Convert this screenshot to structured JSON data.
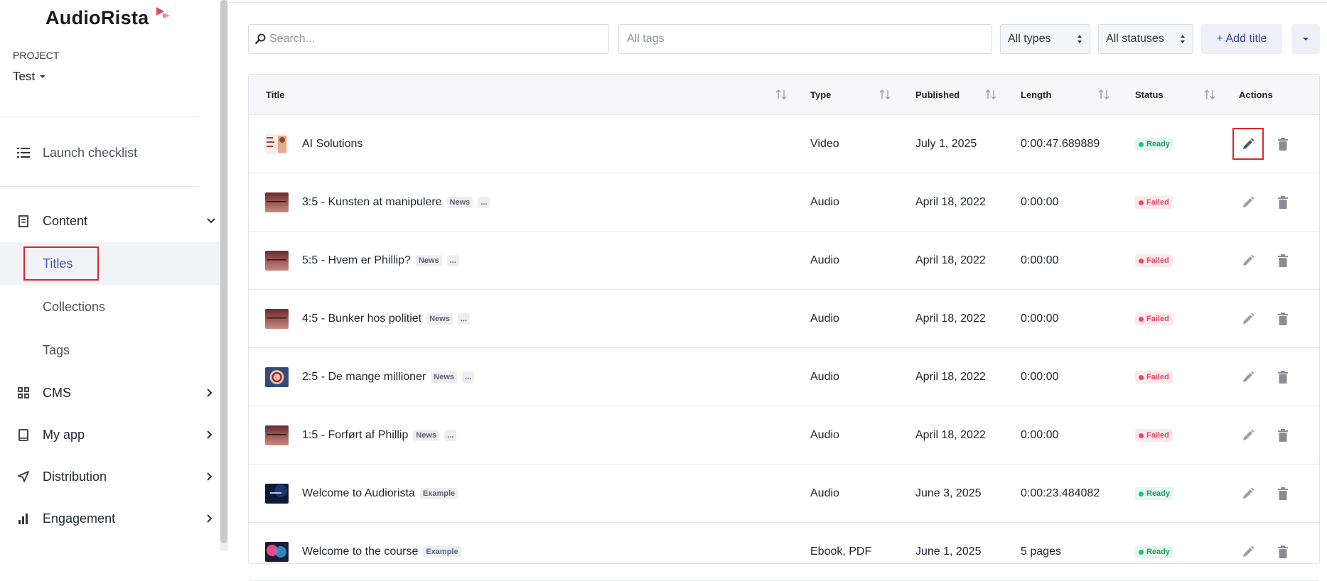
{
  "app": {
    "name": "AudioRista"
  },
  "project": {
    "label": "PROJECT",
    "value": "Test"
  },
  "sidebar": {
    "launch_checklist": "Launch checklist",
    "content": "Content",
    "sub": {
      "titles": "Titles",
      "collections": "Collections",
      "tags": "Tags"
    },
    "cms": "CMS",
    "my_app": "My app",
    "distribution": "Distribution",
    "engagement": "Engagement"
  },
  "toolbar": {
    "search_placeholder": "Search...",
    "tags_placeholder": "All tags",
    "types_value": "All types",
    "statuses_value": "All statuses",
    "add_title": "+ Add title"
  },
  "table": {
    "columns": {
      "title": "Title",
      "type": "Type",
      "published": "Published",
      "length": "Length",
      "status": "Status",
      "actions": "Actions"
    },
    "rows": [
      {
        "title": "AI Solutions",
        "tags": [],
        "type": "Video",
        "published": "July 1, 2025",
        "length": "0:00:47.689889",
        "status": "Ready",
        "thumb": "video"
      },
      {
        "title": "3:5 - Kunsten at manipulere",
        "tags": [
          "News",
          "..."
        ],
        "type": "Audio",
        "published": "April 18, 2022",
        "length": "0:00:00",
        "status": "Failed",
        "thumb": "maroon"
      },
      {
        "title": "5:5 - Hvem er Phillip?",
        "tags": [
          "News",
          "..."
        ],
        "type": "Audio",
        "published": "April 18, 2022",
        "length": "0:00:00",
        "status": "Failed",
        "thumb": "maroon"
      },
      {
        "title": "4:5 - Bunker hos politiet",
        "tags": [
          "News",
          "..."
        ],
        "type": "Audio",
        "published": "April 18, 2022",
        "length": "0:00:00",
        "status": "Failed",
        "thumb": "maroon"
      },
      {
        "title": "2:5 - De mange millioner",
        "tags": [
          "News",
          "..."
        ],
        "type": "Audio",
        "published": "April 18, 2022",
        "length": "0:00:00",
        "status": "Failed",
        "thumb": "coin"
      },
      {
        "title": "1:5 - Forført af Phillip",
        "tags": [
          "News",
          "..."
        ],
        "type": "Audio",
        "published": "April 18, 2022",
        "length": "0:00:00",
        "status": "Failed",
        "thumb": "maroon"
      },
      {
        "title": "Welcome to Audiorista",
        "tags": [
          "Example"
        ],
        "type": "Audio",
        "published": "June 3, 2025",
        "length": "0:00:23.484082",
        "status": "Ready",
        "thumb": "dark-blue"
      },
      {
        "title": "Welcome to the course",
        "tags": [
          "Example"
        ],
        "type": "Ebook, PDF",
        "published": "June 1, 2025",
        "length": "5 pages",
        "status": "Ready",
        "thumb": "colorful"
      }
    ]
  },
  "colors": {
    "accent": "#3a43a0",
    "highlight": "#e0242d",
    "ready": "#1fbf7a",
    "failed": "#f04562"
  }
}
